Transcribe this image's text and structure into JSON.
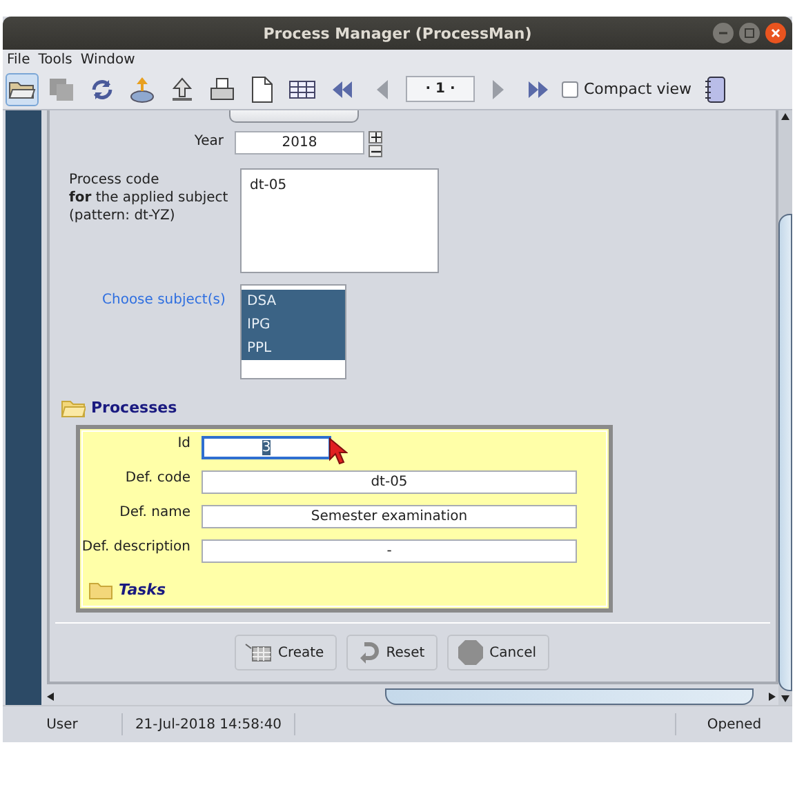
{
  "window": {
    "title": "Process Manager (ProcessMan)"
  },
  "menu": [
    "File",
    "Tools",
    "Window"
  ],
  "toolbar": {
    "page": "· 1 ·",
    "compact_view": {
      "label": "Compact view",
      "checked": false
    }
  },
  "form": {
    "year": {
      "label": "Year",
      "value": "2018"
    },
    "process_code": {
      "label_lines": [
        "Process code",
        "**for** the applied subject",
        "(pattern: dt-YZ)"
      ],
      "value": "dt-05"
    },
    "subjects": {
      "label": "Choose subject(s)",
      "items": [
        {
          "label": "DSA",
          "selected": true
        },
        {
          "label": "IPG",
          "selected": true
        },
        {
          "label": "PPL",
          "selected": true
        }
      ]
    }
  },
  "processes": {
    "title": "Processes",
    "fields": [
      {
        "label": "Id",
        "value": "3",
        "focused": true
      },
      {
        "label": "Def. code",
        "value": "dt-05",
        "focused": false
      },
      {
        "label": "Def. name",
        "value": "Semester examination",
        "focused": false
      },
      {
        "label": "Def. description",
        "value": "-",
        "focused": false
      }
    ],
    "tasks_title": "Tasks"
  },
  "buttons": [
    {
      "kind": "create",
      "label": "Create"
    },
    {
      "kind": "reset",
      "label": "Reset"
    },
    {
      "kind": "cancel",
      "label": "Cancel"
    }
  ],
  "status_bar": {
    "user": "User",
    "datetime": "21-Jul-2018 14:58:40",
    "state": "Opened"
  }
}
